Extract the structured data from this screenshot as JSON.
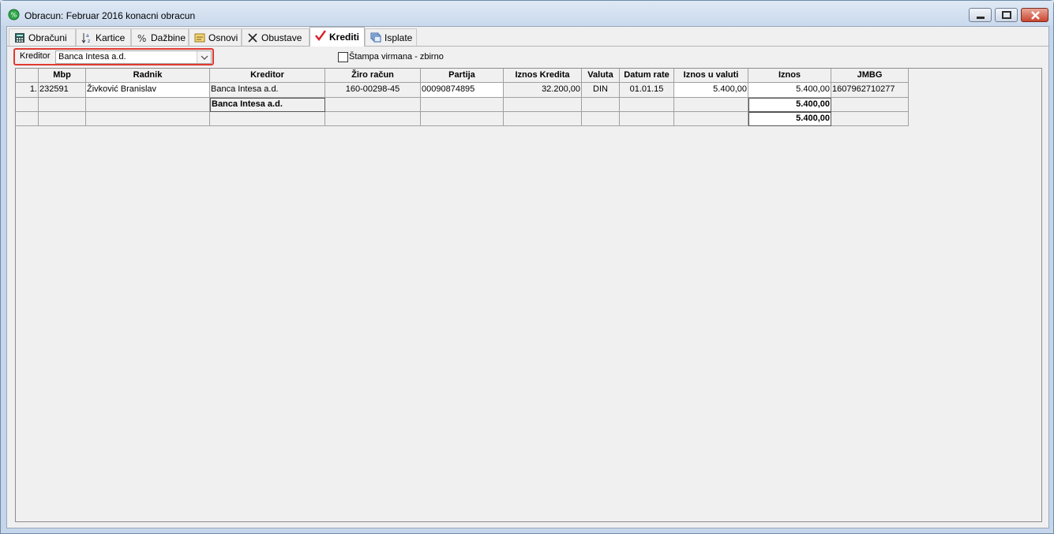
{
  "window": {
    "title": "Obracun: Februar 2016 konacni obracun"
  },
  "tabs": [
    {
      "label": "Obračuni",
      "icon": "calculator-icon"
    },
    {
      "label": "Kartice",
      "icon": "sort-az-icon"
    },
    {
      "label": "Dažbine",
      "icon": "percent-icon"
    },
    {
      "label": "Osnovi",
      "icon": "document-icon"
    },
    {
      "label": "Obustave",
      "icon": "cross-icon"
    },
    {
      "label": "Krediti",
      "icon": "checkmark-icon",
      "active": true
    },
    {
      "label": "Isplate",
      "icon": "stack-icon"
    }
  ],
  "filter": {
    "kreditor_label": "Kreditor",
    "kreditor_value": "Banca Intesa a.d.",
    "stampa_label": "Štampa virmana - zbirno",
    "stampa_checked": false
  },
  "table": {
    "columns": [
      "",
      "Mbp",
      "Radnik",
      "Kreditor",
      "Žiro račun",
      "Partija",
      "Iznos Kredita",
      "Valuta",
      "Datum rate",
      "Iznos u valuti",
      "Iznos",
      "JMBG"
    ],
    "rows": [
      {
        "idx": "1.",
        "mbp": "232591",
        "radnik": "Živković Branislav",
        "kreditor": "Banca Intesa a.d.",
        "ziro": "160-00298-45",
        "partija": "00090874895",
        "iznos_kredita": "32.200,00",
        "valuta": "DIN",
        "datum_rate": "01.01.15",
        "iznos_u_valuti": "5.400,00",
        "iznos": "5.400,00",
        "jmbg": "1607962710277"
      }
    ],
    "subtotal": {
      "kreditor": "Banca Intesa a.d.",
      "iznos": "5.400,00"
    },
    "total": {
      "iznos": "5.400,00"
    }
  },
  "colors": {
    "highlight_border": "#e03a32",
    "title_bar": "#c9d9ec"
  }
}
